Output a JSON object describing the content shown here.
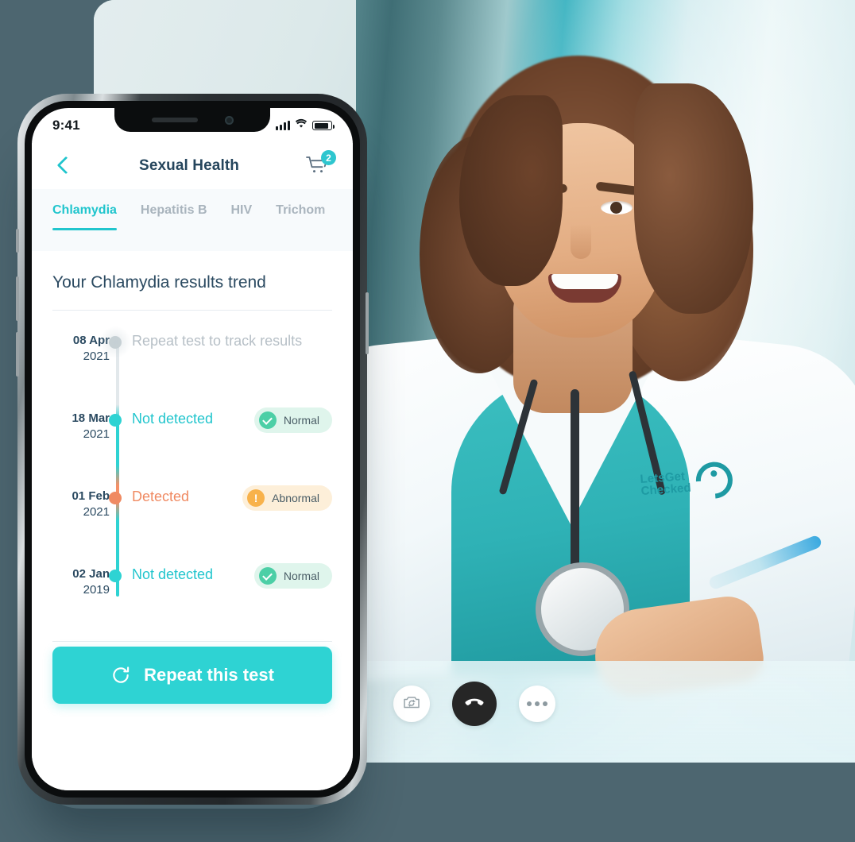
{
  "window": {
    "background_color": "#4d6670"
  },
  "phone": {
    "status_bar": {
      "time": "9:41",
      "signal_icon": "cellular-signal-icon",
      "wifi_icon": "wifi-icon",
      "battery_icon": "battery-icon"
    },
    "nav": {
      "back_icon": "chevron-left-icon",
      "title": "Sexual Health",
      "cart_icon": "shopping-cart-icon",
      "cart_count": "2"
    },
    "tabs": [
      {
        "label": "Chlamydia",
        "active": true
      },
      {
        "label": "Hepatitis B",
        "active": false
      },
      {
        "label": "HIV",
        "active": false
      },
      {
        "label": "Trichom",
        "active": false
      }
    ],
    "content": {
      "heading": "Your Chlamydia results trend",
      "timeline": [
        {
          "day": "08 Apr",
          "year": "2021",
          "result": "Repeat test to track results",
          "state": "pending",
          "badge": null,
          "badge_icon": null
        },
        {
          "day": "18 Mar",
          "year": "2021",
          "result": "Not detected",
          "state": "normal",
          "badge": "Normal",
          "badge_icon": "check-circle-icon"
        },
        {
          "day": "01 Feb",
          "year": "2021",
          "result": "Detected",
          "state": "abnormal",
          "badge": "Abnormal",
          "badge_icon": "exclamation-circle-icon"
        },
        {
          "day": "02 Jan",
          "year": "2019",
          "result": "Not detected",
          "state": "normal",
          "badge": "Normal",
          "badge_icon": "check-circle-icon"
        }
      ],
      "cta": {
        "label": "Repeat this test",
        "icon": "refresh-icon"
      }
    }
  },
  "video_call": {
    "brand": {
      "line1": "LetsGet",
      "line2": "Checked",
      "mark_icon": "letsgetchecked-logo-icon",
      "color": "#1e9aa3"
    },
    "controls": [
      {
        "name": "switch-camera-button",
        "icon": "camera-flip-icon"
      },
      {
        "name": "end-call-button",
        "icon": "phone-hangup-icon"
      },
      {
        "name": "more-options-button",
        "icon": "ellipsis-icon"
      }
    ]
  },
  "colors": {
    "accent_teal": "#2ed3d3",
    "nav_teal": "#21c5cd",
    "heading_navy": "#2b4a61",
    "abnormal_orange": "#f08a62",
    "normal_green": "#4ccfa6",
    "warning_amber": "#f8b24b"
  }
}
